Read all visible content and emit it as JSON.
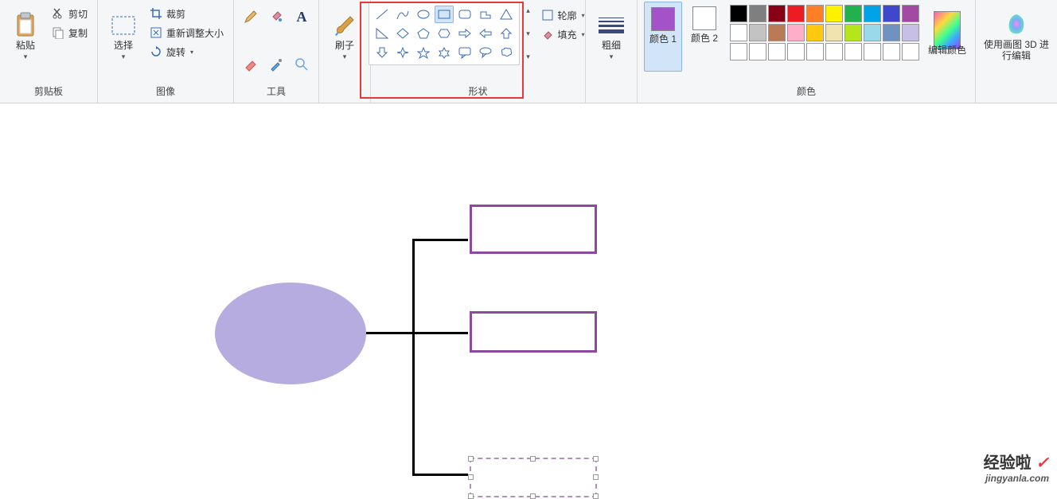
{
  "ribbon": {
    "clipboard": {
      "paste": "粘贴",
      "cut": "剪切",
      "copy": "复制",
      "label": "剪贴板"
    },
    "image": {
      "select": "选择",
      "crop": "裁剪",
      "resize": "重新调整大小",
      "rotate": "旋转",
      "label": "图像"
    },
    "tools": {
      "label": "工具"
    },
    "brush": {
      "brush": "刷子",
      "label": ""
    },
    "shapes": {
      "outline": "轮廓",
      "fill": "填充",
      "label": "形状"
    },
    "thickness": {
      "label": "粗细"
    },
    "colors": {
      "color1": "颜色 1",
      "color2": "颜色 2",
      "edit": "编辑颜色",
      "label": "颜色"
    },
    "paint3d": {
      "label": "使用画图 3D 进行编辑"
    }
  },
  "colors": {
    "color1_hex": "#a352c8",
    "color2_hex": "#ffffff",
    "palette": [
      [
        "#000000",
        "#7f7f7f",
        "#880015",
        "#ed1c24",
        "#ff7f27",
        "#fff200",
        "#22b14c",
        "#00a2e8",
        "#3f48cc",
        "#a349a4"
      ],
      [
        "#ffffff",
        "#c3c3c3",
        "#b97a57",
        "#ffaec9",
        "#ffc90e",
        "#efe4b0",
        "#b5e61d",
        "#99d9ea",
        "#7092be",
        "#c8bfe7"
      ],
      [
        "#ffffff",
        "#ffffff",
        "#ffffff",
        "#ffffff",
        "#ffffff",
        "#ffffff",
        "#ffffff",
        "#ffffff",
        "#ffffff",
        "#ffffff"
      ]
    ]
  },
  "diagram": {
    "ellipse_color": "#b7ace0",
    "rect_border": "#8b4a9e"
  },
  "watermark": {
    "line1_a": "经验啦",
    "line1_b": "✓",
    "line2": "jingyanla.com"
  }
}
